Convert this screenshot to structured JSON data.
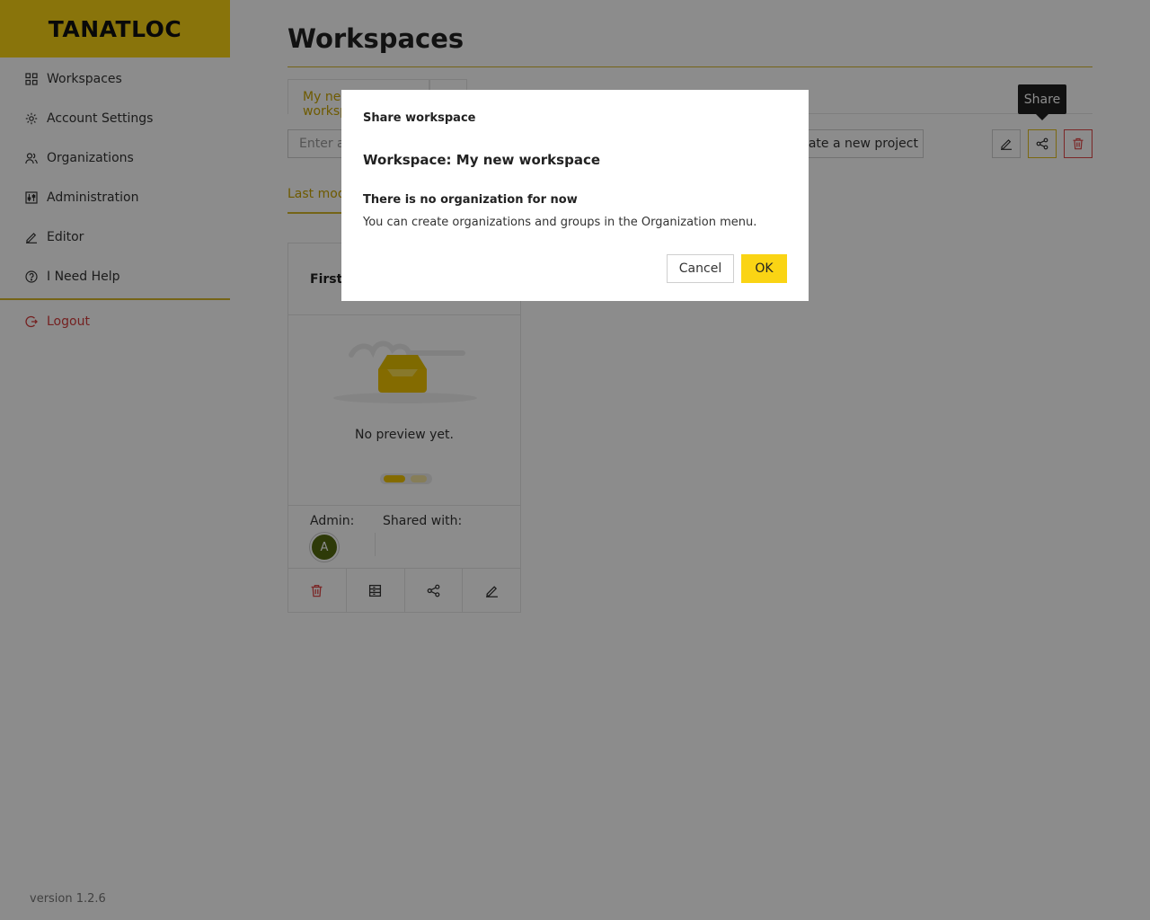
{
  "brand": {
    "logo_text": "TANATLOC",
    "accent": "#fad414",
    "danger": "#e04848"
  },
  "sidebar": {
    "items": [
      {
        "label": "Workspaces",
        "icon": "grid-icon"
      },
      {
        "label": "Account Settings",
        "icon": "gear-icon"
      },
      {
        "label": "Organizations",
        "icon": "users-icon"
      },
      {
        "label": "Administration",
        "icon": "sliders-icon"
      },
      {
        "label": "Editor",
        "icon": "pencil-icon"
      },
      {
        "label": "I Need Help",
        "icon": "help-circle-icon"
      }
    ],
    "logout": "Logout",
    "version": "version 1.2.6"
  },
  "main": {
    "title": "Workspaces",
    "active_tab": "My new workspace",
    "project_placeholder": "Enter a",
    "create_button": "Create a new project",
    "tooltip": "Share",
    "sort_tab": "Last modified"
  },
  "card": {
    "title": "First project",
    "no_preview": "No preview yet.",
    "admin_label": "Admin:",
    "shared_label": "Shared with:",
    "avatar_initial": "A"
  },
  "modal": {
    "header": "Share workspace",
    "workspace_line": "Workspace: My new workspace",
    "no_org": "There is no organization for now",
    "text": "You can create organizations and groups in the Organization menu.",
    "cancel": "Cancel",
    "ok": "OK"
  }
}
